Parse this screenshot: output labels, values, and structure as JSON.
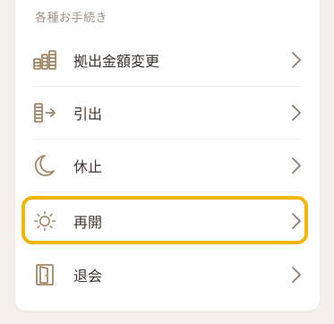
{
  "section": {
    "title": "各種お手続き"
  },
  "menu": {
    "items": [
      {
        "label": "拠出金額変更",
        "icon": "coins-stack-icon"
      },
      {
        "label": "引出",
        "icon": "withdraw-icon"
      },
      {
        "label": "休止",
        "icon": "moon-icon"
      },
      {
        "label": "再開",
        "icon": "sun-icon"
      },
      {
        "label": "退会",
        "icon": "door-exit-icon"
      }
    ],
    "highlighted_index": 3
  },
  "colors": {
    "icon_brown": "#a38765",
    "highlight": "#f2b705",
    "background": "#f6f0ec",
    "card": "#ffffff",
    "text": "#3c3532",
    "muted_text": "#9a918c"
  }
}
